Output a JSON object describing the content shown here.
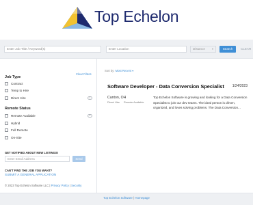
{
  "brand": {
    "name": "Top Echelon",
    "color": "#1e2a6e",
    "accent": "#3f8fd6"
  },
  "search": {
    "keywords_placeholder": "Enter Job Title / Keyword(s)",
    "location_placeholder": "Enter Location",
    "distance_label": "Distance",
    "search_button": "Search",
    "clear_button": "CLEAR"
  },
  "sidebar": {
    "clear_filters": "Clear Filters",
    "job_type": {
      "title": "Job Type",
      "items": [
        {
          "label": "Contract",
          "count": ""
        },
        {
          "label": "Temp to Hire",
          "count": ""
        },
        {
          "label": "Direct Hire",
          "count": "1"
        }
      ]
    },
    "remote_status": {
      "title": "Remote Status",
      "items": [
        {
          "label": "Remote Available",
          "count": "1"
        },
        {
          "label": "Hybrid",
          "count": ""
        },
        {
          "label": "Full Remote",
          "count": ""
        },
        {
          "label": "On-Site",
          "count": ""
        }
      ]
    },
    "notify": {
      "title": "GET NOTIFIED ABOUT NEW LISTINGS!",
      "email_placeholder": "Enter Email Address",
      "button": "Send"
    },
    "cant_find": {
      "title": "CAN'T FIND THE JOB YOU WANT?",
      "link": "SUBMIT A GENERAL APPLICATION"
    },
    "copyright": {
      "text": "© 2023 Top Echelon Software LLC |",
      "privacy": "Privacy Policy",
      "sep": "|",
      "security": "Security"
    }
  },
  "results": {
    "sort_label": "Sort by:",
    "sort_value": "Most Recent",
    "sort_chevron": "chevron-down-icon",
    "jobs": [
      {
        "title": "Software Developer - Data Conversion Specialist",
        "date": "1/24/2023",
        "location": "Canton, OH",
        "tags": [
          "Direct Hire",
          "Remote Available"
        ],
        "description": "Top Echelon Software is growing and looking for a Data Conversion Specialist to join our dev teams. The ideal person is driven, organized, and loves solving problems. The Data Conversion..."
      }
    ]
  },
  "footer": {
    "link": "Top Echelon Software",
    "sep": "|",
    "homepage": "Homepage"
  }
}
